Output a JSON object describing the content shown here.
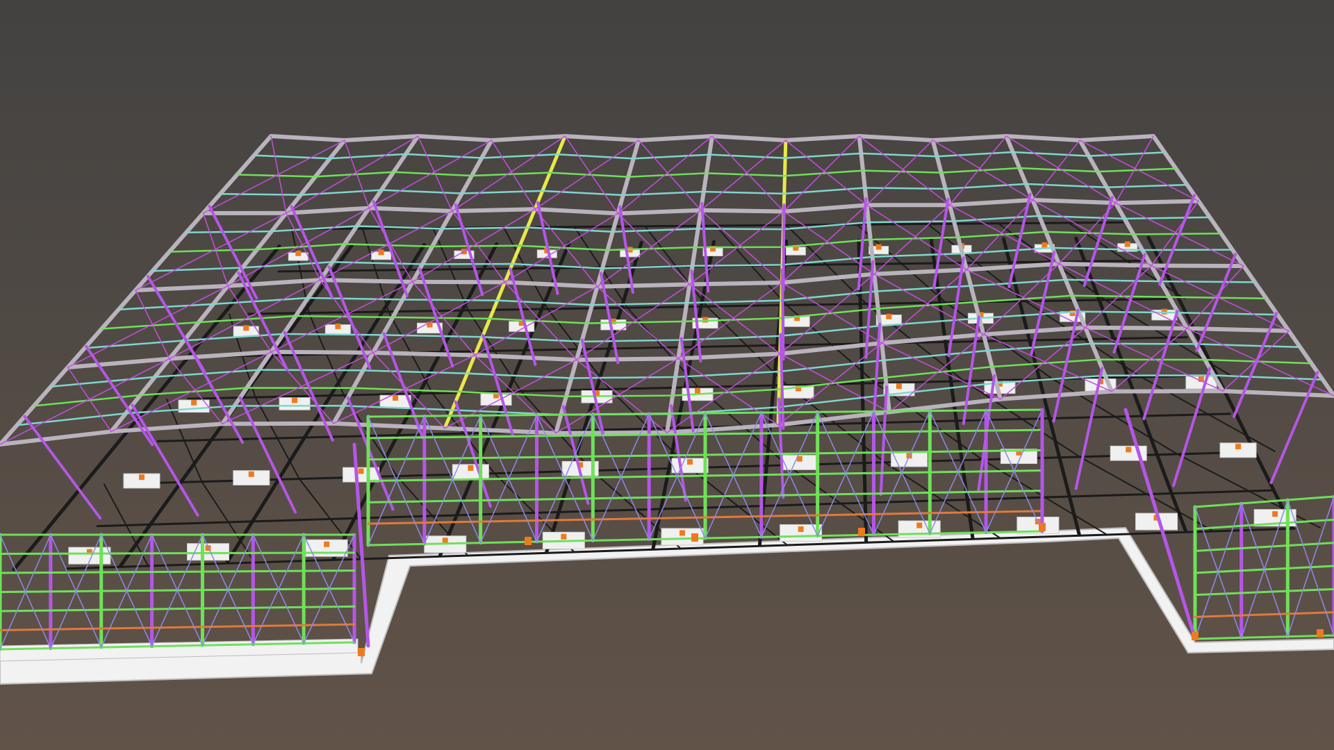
{
  "scene": {
    "subject": "steel-frame-structure-3d-model",
    "background": {
      "top": "#434241",
      "bottom": "#615348"
    },
    "colors": {
      "slab": "#f2f2f2",
      "slab_edge": "#bdbdbd",
      "column": "#b556e8",
      "bracing": "#c44fe0",
      "rafter": "#b9b3bd",
      "purlin_green": "#6fe05a",
      "purlin_cyan": "#7fd6cf",
      "purlin_yellow": "#e8e84a",
      "girt_orange": "#e07a3a",
      "shadow": "#1b1b1b",
      "base_plate": "#f0f0f0",
      "anchor": "#ee7a1e",
      "tie_blue": "#8c8ce8"
    },
    "element_counts": {
      "frames": 12,
      "bays": 6
    }
  }
}
